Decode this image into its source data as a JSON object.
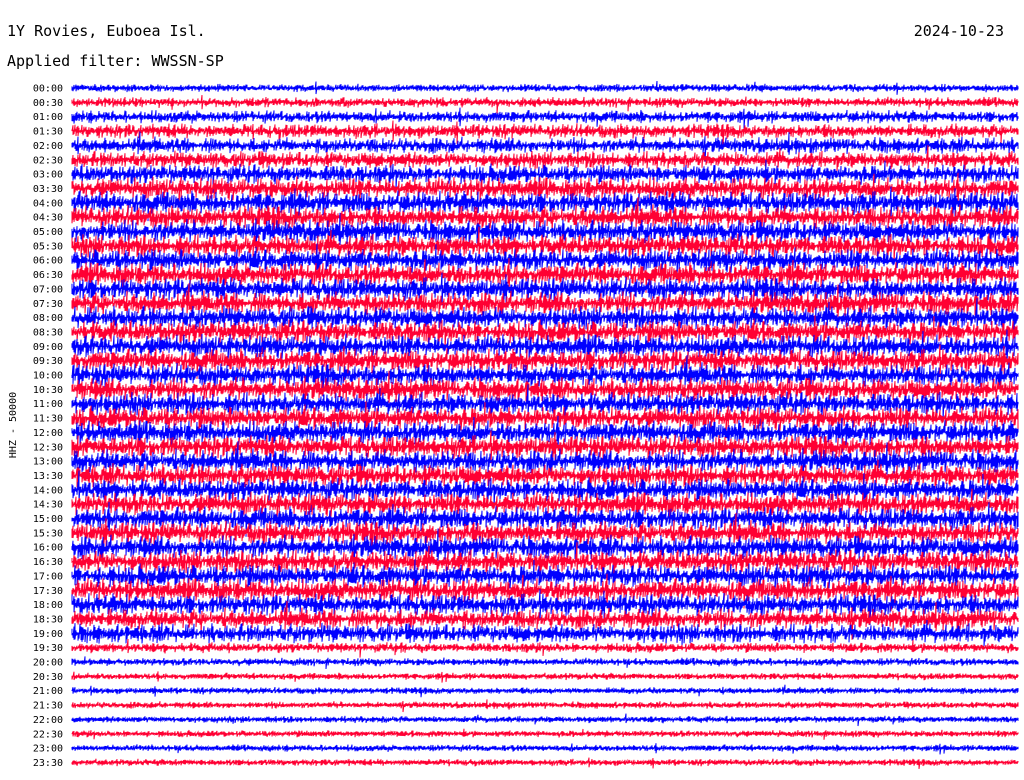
{
  "header": {
    "station": "1Y Rovies, Euboea Isl.",
    "date": "2024-10-23",
    "filter": "Applied filter: WWSSN-SP"
  },
  "chart_data": {
    "type": "helicorder",
    "title": "1Y Rovies, Euboea Isl.",
    "date": "2024-10-23",
    "filter": "WWSSN-SP",
    "ylabel": "HHZ - 50000",
    "row_minutes": 30,
    "colors": [
      "#0000ff",
      "#ff0033"
    ],
    "rows": [
      {
        "time": "00:00",
        "amp": 0.35
      },
      {
        "time": "00:30",
        "amp": 0.45
      },
      {
        "time": "01:00",
        "amp": 0.55
      },
      {
        "time": "01:30",
        "amp": 0.65
      },
      {
        "time": "02:00",
        "amp": 0.7
      },
      {
        "time": "02:30",
        "amp": 0.75
      },
      {
        "time": "03:00",
        "amp": 0.85
      },
      {
        "time": "03:30",
        "amp": 0.95
      },
      {
        "time": "04:00",
        "amp": 1.0
      },
      {
        "time": "04:30",
        "amp": 1.0
      },
      {
        "time": "05:00",
        "amp": 1.0
      },
      {
        "time": "05:30",
        "amp": 1.0
      },
      {
        "time": "06:00",
        "amp": 1.0
      },
      {
        "time": "06:30",
        "amp": 1.0
      },
      {
        "time": "07:00",
        "amp": 1.0
      },
      {
        "time": "07:30",
        "amp": 1.0
      },
      {
        "time": "08:00",
        "amp": 1.0
      },
      {
        "time": "08:30",
        "amp": 1.0
      },
      {
        "time": "09:00",
        "amp": 1.0
      },
      {
        "time": "09:30",
        "amp": 1.0
      },
      {
        "time": "10:00",
        "amp": 1.0
      },
      {
        "time": "10:30",
        "amp": 1.0
      },
      {
        "time": "11:00",
        "amp": 1.0
      },
      {
        "time": "11:30",
        "amp": 1.0
      },
      {
        "time": "12:00",
        "amp": 1.0
      },
      {
        "time": "12:30",
        "amp": 1.0
      },
      {
        "time": "13:00",
        "amp": 1.0
      },
      {
        "time": "13:30",
        "amp": 1.0
      },
      {
        "time": "14:00",
        "amp": 1.0
      },
      {
        "time": "14:30",
        "amp": 1.0
      },
      {
        "time": "15:00",
        "amp": 1.0
      },
      {
        "time": "15:30",
        "amp": 1.0
      },
      {
        "time": "16:00",
        "amp": 1.0
      },
      {
        "time": "16:30",
        "amp": 1.0
      },
      {
        "time": "17:00",
        "amp": 1.0
      },
      {
        "time": "17:30",
        "amp": 1.0
      },
      {
        "time": "18:00",
        "amp": 0.95
      },
      {
        "time": "18:30",
        "amp": 0.9
      },
      {
        "time": "19:00",
        "amp": 0.85
      },
      {
        "time": "19:30",
        "amp": 0.45
      },
      {
        "time": "20:00",
        "amp": 0.35
      },
      {
        "time": "20:30",
        "amp": 0.3
      },
      {
        "time": "21:00",
        "amp": 0.3
      },
      {
        "time": "21:30",
        "amp": 0.3
      },
      {
        "time": "22:00",
        "amp": 0.3
      },
      {
        "time": "22:30",
        "amp": 0.3
      },
      {
        "time": "23:00",
        "amp": 0.3
      },
      {
        "time": "23:30",
        "amp": 0.3
      }
    ]
  }
}
